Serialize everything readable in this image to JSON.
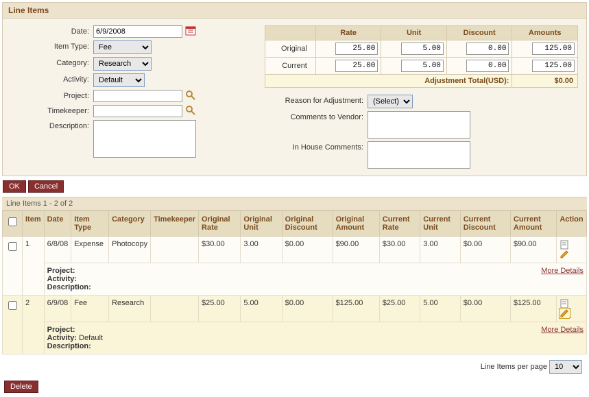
{
  "panel": {
    "title": "Line Items"
  },
  "form": {
    "labels": {
      "date": "Date:",
      "item_type": "Item Type:",
      "category": "Category:",
      "activity": "Activity:",
      "project": "Project:",
      "timekeeper": "Timekeeper:",
      "description": "Description:",
      "reason": "Reason for Adjustment:",
      "comments_vendor": "Comments to Vendor:",
      "comments_house": "In House Comments:"
    },
    "values": {
      "date": "6/9/2008",
      "item_type": "Fee",
      "category": "Research",
      "activity": "Default",
      "project": "",
      "timekeeper": "",
      "description": "",
      "reason": "(Select)",
      "comments_vendor": "",
      "comments_house": ""
    }
  },
  "rates": {
    "headers": {
      "blank": "",
      "rate": "Rate",
      "unit": "Unit",
      "discount": "Discount",
      "amounts": "Amounts"
    },
    "rows": [
      {
        "label": "Original",
        "rate": "25.00",
        "unit": "5.00",
        "discount": "0.00",
        "amount": "125.00"
      },
      {
        "label": "Current",
        "rate": "25.00",
        "unit": "5.00",
        "discount": "0.00",
        "amount": "125.00"
      }
    ],
    "adjustment_label": "Adjustment Total(USD):",
    "adjustment_value": "$0.00"
  },
  "buttons": {
    "ok": "OK",
    "cancel": "Cancel",
    "delete": "Delete"
  },
  "grid": {
    "summary": "Line Items 1 - 2 of 2",
    "headers": {
      "item": "Item",
      "date": "Date",
      "item_type": "Item Type",
      "category": "Category",
      "timekeeper": "Timekeeper",
      "orig_rate": "Original Rate",
      "orig_unit": "Original Unit",
      "orig_disc": "Original Discount",
      "orig_amt": "Original Amount",
      "cur_rate": "Current Rate",
      "cur_unit": "Current Unit",
      "cur_disc": "Current Discount",
      "cur_amt": "Current Amount",
      "action": "Action"
    },
    "detail_labels": {
      "project": "Project:",
      "activity": "Activity:",
      "description": "Description:"
    },
    "more_link": "More Details",
    "rows": [
      {
        "item": "1",
        "date": "6/8/08",
        "item_type": "Expense",
        "category": "Photocopy",
        "timekeeper": "",
        "orig_rate": "$30.00",
        "orig_unit": "3.00",
        "orig_disc": "$0.00",
        "orig_amt": "$90.00",
        "cur_rate": "$30.00",
        "cur_unit": "3.00",
        "cur_disc": "$0.00",
        "cur_amt": "$90.00",
        "project": "",
        "activity": "",
        "description": "",
        "highlighted": false
      },
      {
        "item": "2",
        "date": "6/9/08",
        "item_type": "Fee",
        "category": "Research",
        "timekeeper": "",
        "orig_rate": "$25.00",
        "orig_unit": "5.00",
        "orig_disc": "$0.00",
        "orig_amt": "$125.00",
        "cur_rate": "$25.00",
        "cur_unit": "5.00",
        "cur_disc": "$0.00",
        "cur_amt": "$125.00",
        "project": "",
        "activity": "Default",
        "description": "",
        "highlighted": true
      }
    ]
  },
  "pager": {
    "label": "Line Items per page",
    "value": "10"
  }
}
